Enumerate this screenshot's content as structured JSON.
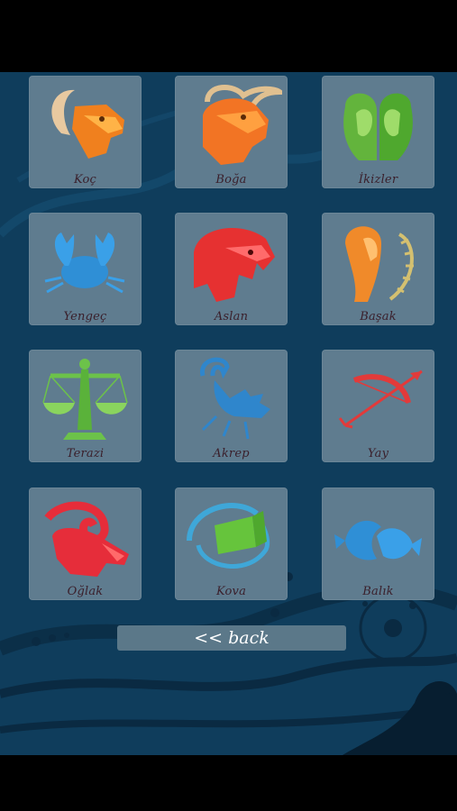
{
  "signs": [
    {
      "label": "Koç",
      "icon": "aries-ram-head-icon"
    },
    {
      "label": "Boğa",
      "icon": "taurus-bull-icon"
    },
    {
      "label": "İkizler",
      "icon": "gemini-twins-icon"
    },
    {
      "label": "Yengeç",
      "icon": "cancer-crab-icon"
    },
    {
      "label": "Aslan",
      "icon": "leo-lion-icon"
    },
    {
      "label": "Başak",
      "icon": "virgo-maiden-icon"
    },
    {
      "label": "Terazi",
      "icon": "libra-scales-icon"
    },
    {
      "label": "Akrep",
      "icon": "scorpio-scorpion-icon"
    },
    {
      "label": "Yay",
      "icon": "sagittarius-bow-icon"
    },
    {
      "label": "Oğlak",
      "icon": "capricorn-goat-icon"
    },
    {
      "label": "Kova",
      "icon": "aquarius-water-icon"
    },
    {
      "label": "Balık",
      "icon": "pisces-fish-icon"
    }
  ],
  "back_button": {
    "label": "<< back"
  },
  "colors": {
    "background": "#0f3d5c",
    "tile": "#5f7c8f",
    "label": "#3a1f2b",
    "button": "#5b7889"
  }
}
